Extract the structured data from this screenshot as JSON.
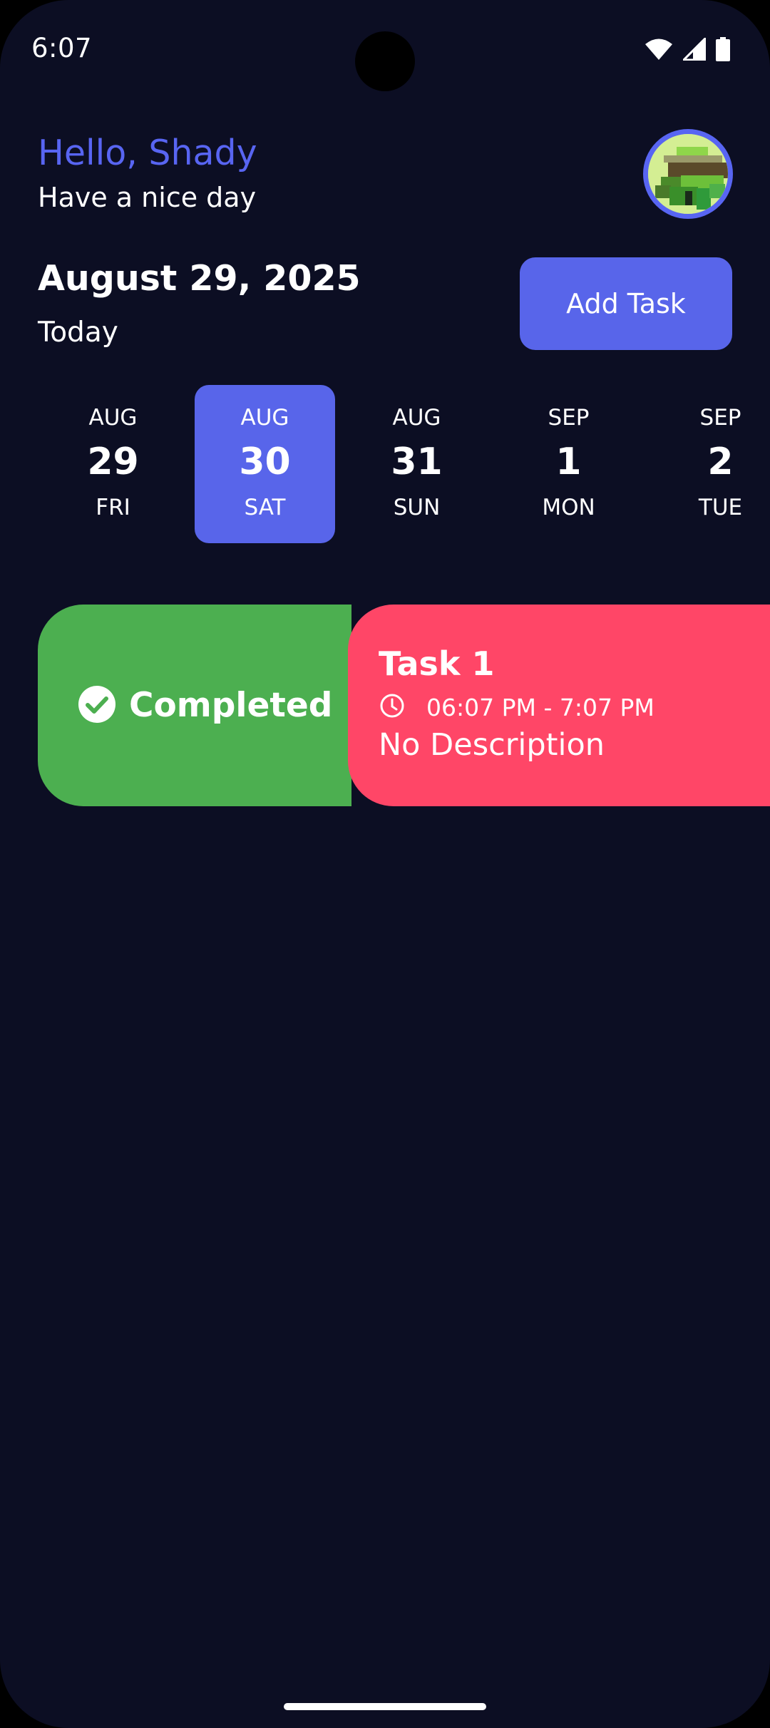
{
  "status_bar": {
    "time": "6:07",
    "icons": [
      "wifi-icon",
      "signal-icon",
      "battery-icon"
    ]
  },
  "header": {
    "greeting": "Hello, Shady",
    "subtitle": "Have a nice day",
    "avatar_icon": "pixel-avatar"
  },
  "date_section": {
    "date": "August 29, 2025",
    "label": "Today",
    "add_task_label": "Add Task"
  },
  "date_strip": {
    "days": [
      {
        "month": "AUG",
        "day": "29",
        "weekday": "FRI",
        "selected": false
      },
      {
        "month": "AUG",
        "day": "30",
        "weekday": "SAT",
        "selected": true
      },
      {
        "month": "AUG",
        "day": "31",
        "weekday": "SUN",
        "selected": false
      },
      {
        "month": "SEP",
        "day": "1",
        "weekday": "MON",
        "selected": false
      },
      {
        "month": "SEP",
        "day": "2",
        "weekday": "TUE",
        "selected": false
      }
    ]
  },
  "tasks": [
    {
      "title": "Task 1",
      "time": "06:07 PM - 7:07 PM",
      "description": "No Description",
      "swipe_action": "Completed"
    }
  ],
  "colors": {
    "background": "#0c0e23",
    "accent": "#5865ea",
    "completed": "#4caf50",
    "task": "#ff4667"
  }
}
